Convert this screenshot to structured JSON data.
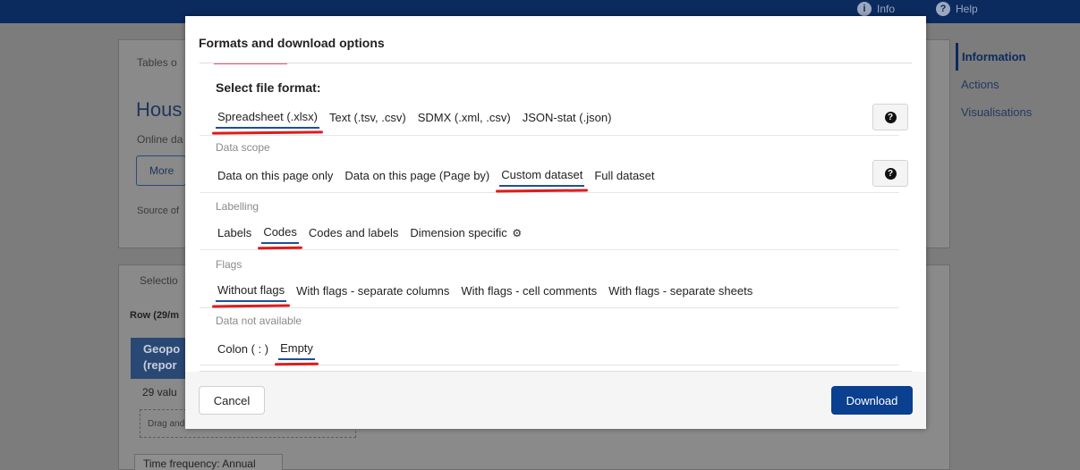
{
  "header": {
    "info_label": "Info",
    "help_label": "Help"
  },
  "background": {
    "breadcrumb": "Tables o",
    "title": "Hous",
    "subtitle": "Online da",
    "more_button": "More",
    "source": "Source of",
    "selection_tab": "Selectio",
    "row_label": "Row (29/m",
    "geo_line1": "Geopo",
    "geo_line2": "(repor",
    "values_count": "29 valu",
    "drag_hint": "Drag and",
    "time_frequency": "Time frequency: Annual"
  },
  "side_nav": {
    "items": [
      {
        "label": "Information",
        "active": true
      },
      {
        "label": "Actions",
        "active": false
      },
      {
        "label": "Visualisations",
        "active": false
      }
    ]
  },
  "modal": {
    "title": "Formats and download options",
    "file_format": {
      "title": "Select file format:",
      "options": [
        "Spreadsheet (.xlsx)",
        "Text (.tsv, .csv)",
        "SDMX (.xml, .csv)",
        "JSON-stat (.json)"
      ],
      "selected": "Spreadsheet (.xlsx)"
    },
    "data_scope": {
      "label": "Data scope",
      "options": [
        "Data on this page only",
        "Data on this page (Page by)",
        "Custom dataset",
        "Full dataset"
      ],
      "selected": "Custom dataset"
    },
    "labelling": {
      "label": "Labelling",
      "options": [
        "Labels",
        "Codes",
        "Codes and labels",
        "Dimension specific"
      ],
      "selected": "Codes"
    },
    "flags": {
      "label": "Flags",
      "options": [
        "Without flags",
        "With flags - separate columns",
        "With flags - cell comments",
        "With flags - separate sheets"
      ],
      "selected": "Without flags"
    },
    "not_available": {
      "label": "Data not available",
      "options": [
        "Colon ( : )",
        "Empty"
      ],
      "selected": "Empty"
    },
    "cancel_label": "Cancel",
    "download_label": "Download"
  },
  "colors": {
    "accent": "#0b3f8f",
    "header_bg": "#0b2a5e",
    "selection_underline": "#1d4f9a",
    "annotation_red": "#e01b1b"
  }
}
